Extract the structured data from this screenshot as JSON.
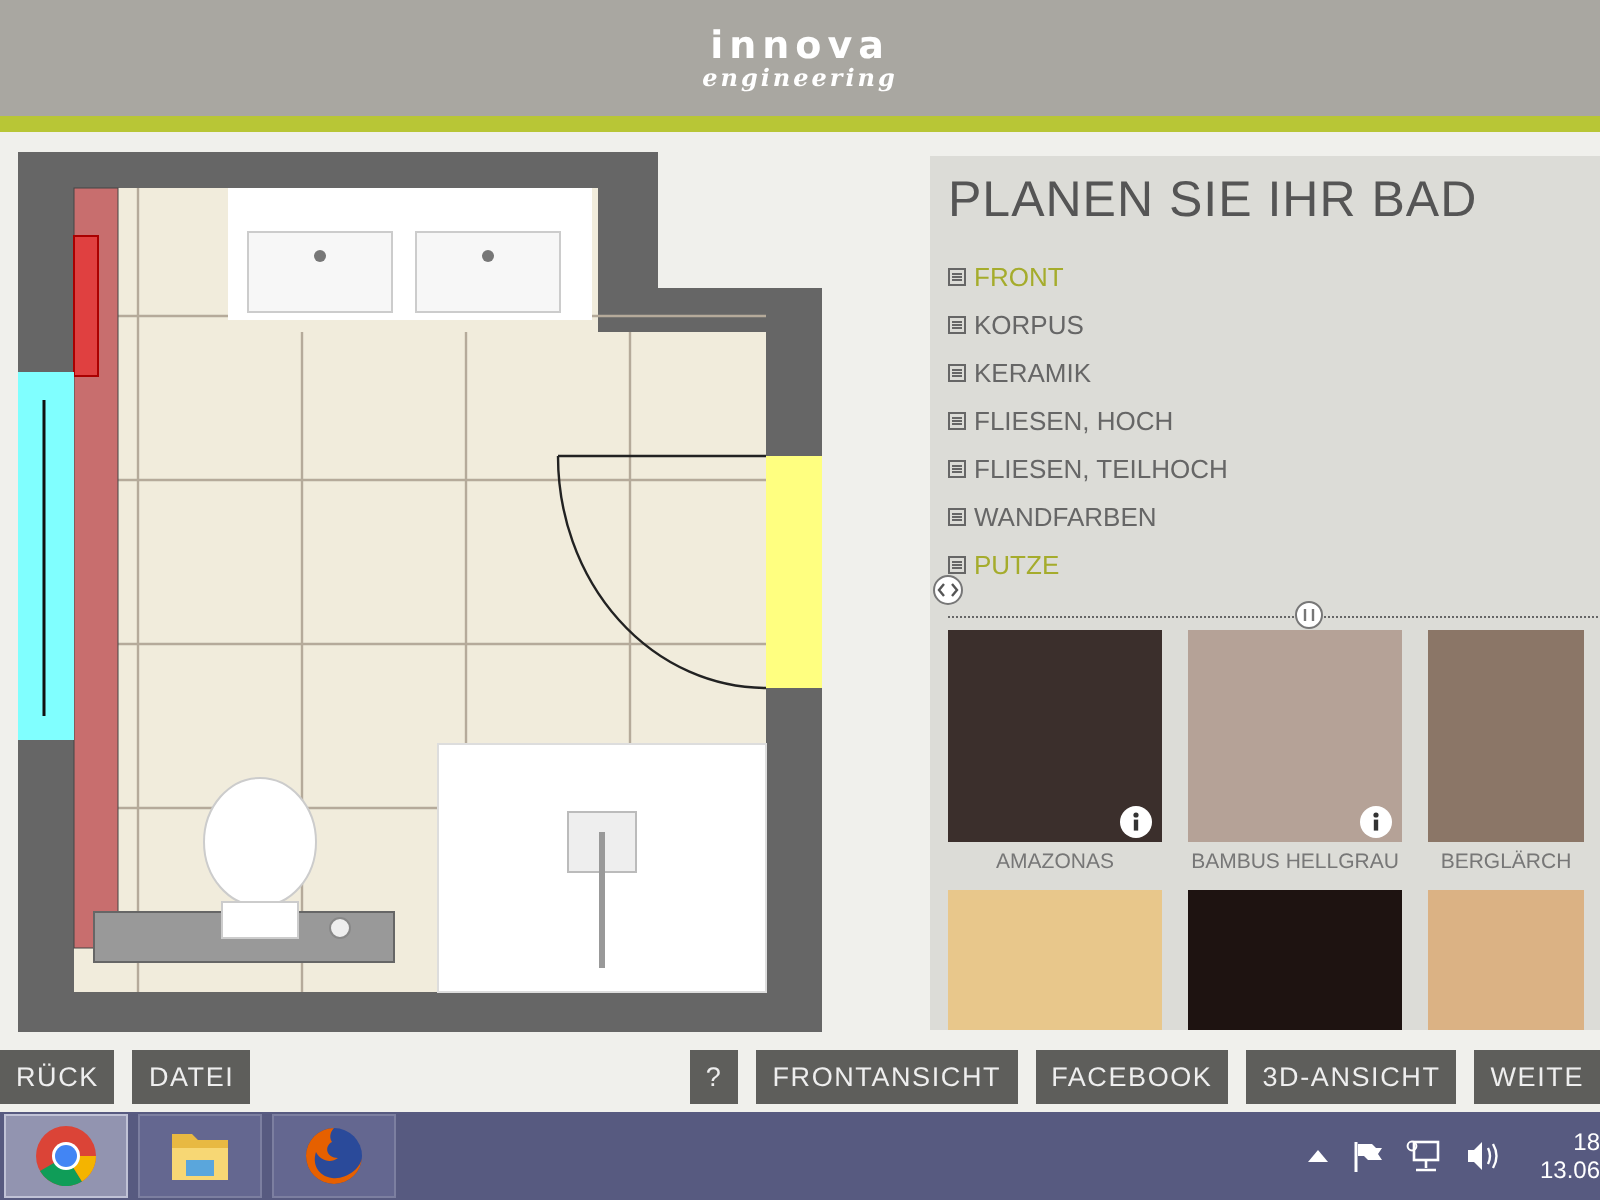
{
  "header": {
    "logo": "innova",
    "tagline": "engineering"
  },
  "panel": {
    "title": "PLANEN SIE IHR BAD",
    "menu": [
      {
        "label": "FRONT",
        "selected": true
      },
      {
        "label": "KORPUS",
        "selected": false
      },
      {
        "label": "KERAMIK",
        "selected": false
      },
      {
        "label": "FLIESEN, HOCH",
        "selected": false
      },
      {
        "label": "FLIESEN, TEILHOCH",
        "selected": false
      },
      {
        "label": "WANDFARBEN",
        "selected": false
      },
      {
        "label": "PUTZE",
        "selected": true
      }
    ],
    "swatches": [
      {
        "label": "AMAZONAS",
        "color": "#3b2f2c",
        "info": true
      },
      {
        "label": "BAMBUS HELLGRAU",
        "color": "#b5a297",
        "info": true
      },
      {
        "label": "BERGLÄRCH",
        "color": "#8b7667",
        "info": false
      },
      {
        "color": "#e8c78b"
      },
      {
        "color": "#1e1311"
      },
      {
        "color": "#dbb284"
      }
    ]
  },
  "toolbar": {
    "left": [
      "RÜCK",
      "DATEI"
    ],
    "right": [
      "?",
      "FRONTANSICHT",
      "FACEBOOK",
      "3D-ANSICHT",
      "WEITE"
    ]
  },
  "taskbar": {
    "apps": [
      {
        "kind": "chrome",
        "selected": true
      },
      {
        "kind": "folder",
        "selected": false
      },
      {
        "kind": "firefox",
        "selected": false
      }
    ],
    "time": "18",
    "date": "13.06"
  }
}
